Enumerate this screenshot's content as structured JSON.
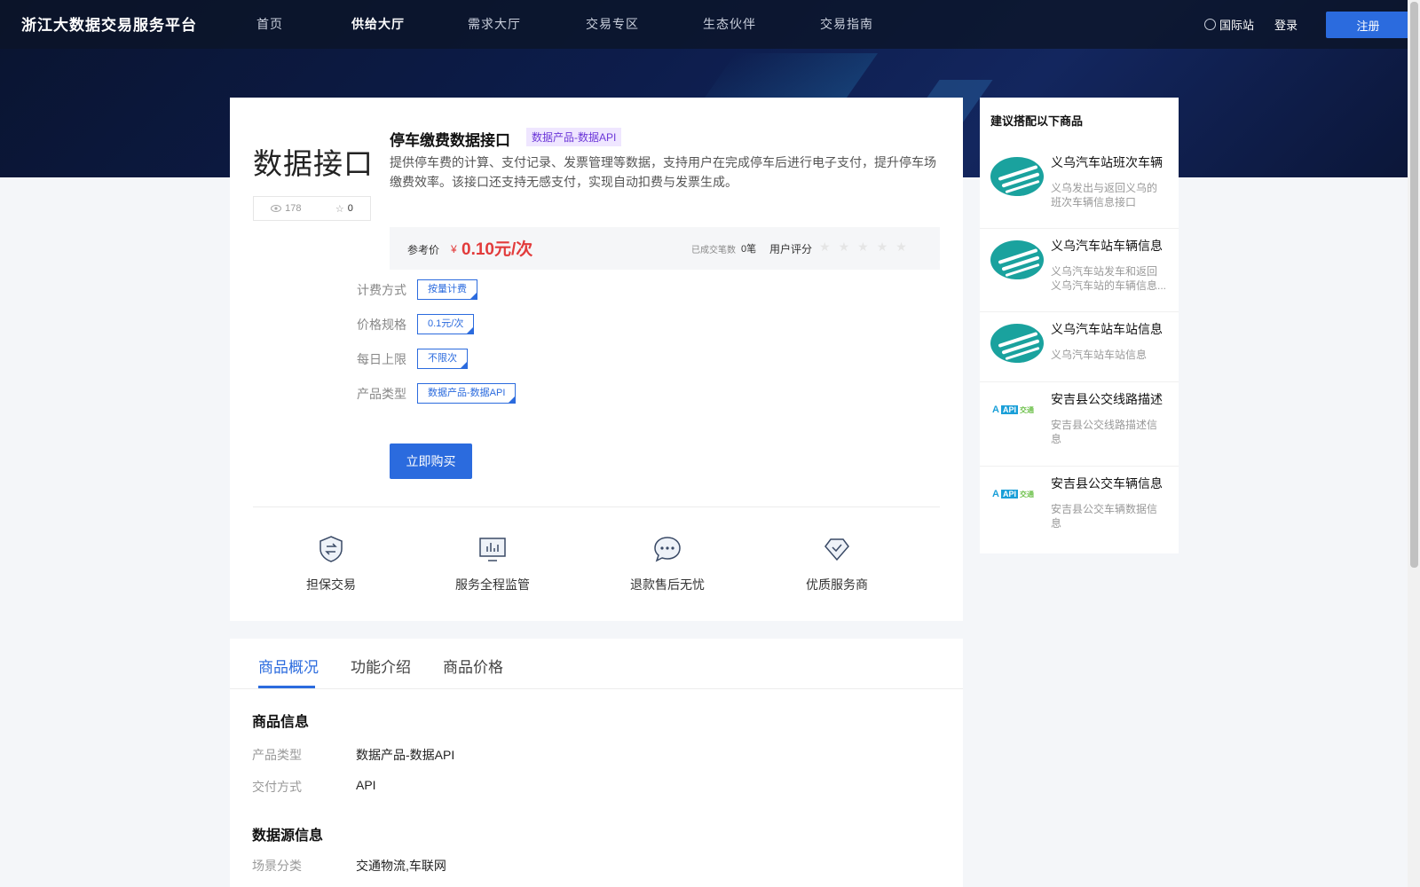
{
  "header": {
    "logo": "浙江大数据交易服务平台",
    "nav": [
      "首页",
      "供给大厅",
      "需求大厅",
      "交易专区",
      "生态伙伴",
      "交易指南"
    ],
    "active_nav": "供给大厅",
    "intl": "国际站",
    "login": "登录",
    "register": "注册"
  },
  "product": {
    "big_title": "数据接口",
    "views": "178",
    "favorites": "0",
    "title": "停车缴费数据接口",
    "tag": "数据产品-数据API",
    "description": "提供停车费的计算、支付记录、发票管理等数据，支持用户在完成停车后进行电子支付，提升停车场缴费效率。该接口还支持无感支付，实现自动扣费与发票生成。",
    "price_label": "参考价",
    "currency": "¥",
    "price": "0.10元/次",
    "trades_label": "已成交笔数",
    "trades": "0笔",
    "rating_label": "用户评分",
    "rating": 0,
    "rating_max": 5,
    "specs": [
      {
        "label": "计费方式",
        "value": "按量计费"
      },
      {
        "label": "价格规格",
        "value": "0.1元/次"
      },
      {
        "label": "每日上限",
        "value": "不限次"
      },
      {
        "label": "产品类型",
        "value": "数据产品-数据API"
      }
    ],
    "buy": "立即购买",
    "features": [
      "担保交易",
      "服务全程监管",
      "退款售后无忧",
      "优质服务商"
    ]
  },
  "sidebar": {
    "title": "建议搭配以下商品",
    "items": [
      {
        "name": "义乌汽车站班次车辆",
        "desc": "义乌发出与返回义乌的班次车辆信息接口",
        "logo": "yiwu-bus-logo"
      },
      {
        "name": "义乌汽车站车辆信息",
        "desc": "义乌汽车站发车和返回义乌汽车站的车辆信息...",
        "logo": "yiwu-bus-logo"
      },
      {
        "name": "义乌汽车站车站信息",
        "desc": "义乌汽车站车站信息",
        "logo": "yiwu-bus-logo"
      },
      {
        "name": "安吉县公交线路描述",
        "desc": "安吉县公交线路描述信息",
        "logo": "anji-api-logo"
      },
      {
        "name": "安吉县公交车辆信息",
        "desc": "安吉县公交车辆数据信息",
        "logo": "anji-api-logo"
      }
    ]
  },
  "detail": {
    "tabs": [
      "商品概况",
      "功能介绍",
      "商品价格"
    ],
    "active_tab": "商品概况",
    "sections": [
      {
        "title": "商品信息",
        "rows": [
          {
            "label": "产品类型",
            "value": "数据产品-数据API"
          },
          {
            "label": "交付方式",
            "value": "API"
          }
        ]
      },
      {
        "title": "数据源信息",
        "rows": [
          {
            "label": "场景分类",
            "value": "交通物流,车联网"
          }
        ]
      }
    ]
  },
  "colors": {
    "accent": "#2b6bde",
    "price": "#e23b3b",
    "tag_bg": "#efe6ff",
    "tag_text": "#6c37d8",
    "header_bg": "#0d1d4c"
  }
}
